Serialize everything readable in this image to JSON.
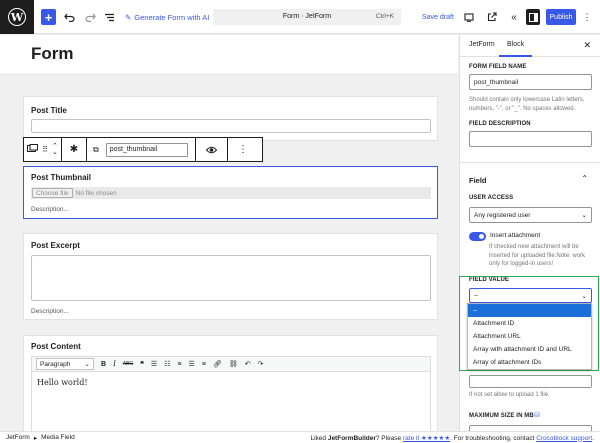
{
  "topbar": {
    "generate_label": "Generate Form with AI",
    "doc_title": "Form · JetForm",
    "shortcut": "Ctrl+K",
    "save_draft": "Save draft",
    "publish": "Publish"
  },
  "editor": {
    "page_title": "Form",
    "toolbar": {
      "field_name": "post_thumbnail"
    },
    "blocks": {
      "post_title": {
        "label": "Post Title"
      },
      "post_thumbnail": {
        "label": "Post Thumbnail",
        "choose_file": "Choose file",
        "no_file": "No file chosen",
        "description": "Description..."
      },
      "post_excerpt": {
        "label": "Post Excerpt",
        "description": "Description..."
      },
      "post_content": {
        "label": "Post Content",
        "format": "Paragraph",
        "content": "Hello world!"
      }
    }
  },
  "sidebar": {
    "tabs": [
      "JetForm",
      "Block"
    ],
    "active_tab": "Block",
    "form_field_name_label": "FORM FIELD NAME",
    "form_field_name_value": "post_thumbnail",
    "form_field_name_help": "Should contain only lowercase Latin letters, numbers, \"-\", or \"_\". No spaces allowed.",
    "field_description_label": "FIELD DESCRIPTION",
    "field_section": "Field",
    "user_access_label": "USER ACCESS",
    "user_access_value": "Any registered user",
    "insert_attachment_label": "Insert attachment",
    "insert_attachment_help": "If checked new attachment will be inserted for uploaded file.Note: work only for logged-in users!",
    "field_value_label": "FIELD VALUE",
    "field_value_current": "--",
    "field_value_options": [
      "--",
      "Attachment ID",
      "Attachment URL",
      "Array with attachment ID and URL",
      "Array of attachment IDs"
    ],
    "field_value_selected_index": 0,
    "max_files_help": "If not set allow to upload 1 file.",
    "max_size_label": "MAXIMUM SIZE IN MB"
  },
  "footer": {
    "breadcrumb_root": "JetForm",
    "breadcrumb_current": "Media Field",
    "liked_prefix": "Liked ",
    "plugin_name": "JetFormBuilder",
    "please_text": "? Please ",
    "rate_link": "rate it ★★★★★",
    "troubleshoot_text": ". For troubleshooting, contact ",
    "support_link": "Crocoblock support",
    "end_text": "."
  },
  "colors": {
    "accent": "#3858e9",
    "highlight": "#2ea84f",
    "selected_option": "#1b6fd8"
  }
}
